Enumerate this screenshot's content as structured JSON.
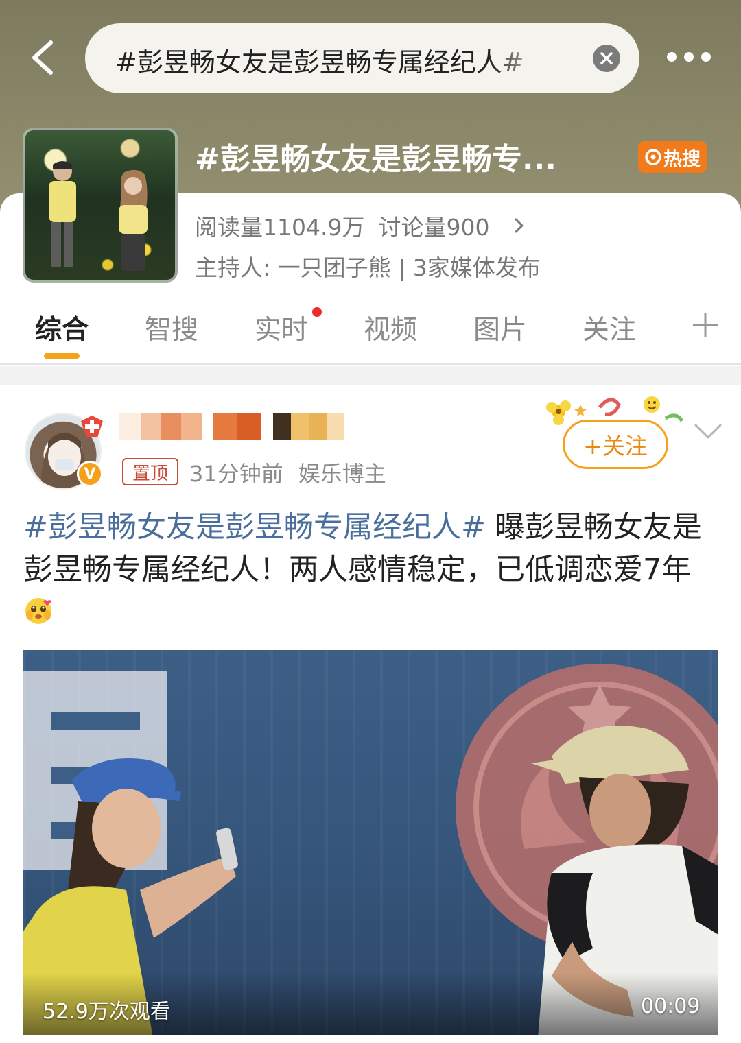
{
  "header": {
    "search_query": "#彭昱畅女友是彭昱畅专属经纪人#",
    "back_icon": "chevron-left-icon",
    "clear_icon": "close-icon",
    "more_icon": "more-dots-icon"
  },
  "topic": {
    "title": "#彭昱畅女友是彭昱畅专...",
    "hot_badge": "热搜",
    "reads_label": "阅读量1104.9万",
    "discussion_label": "讨论量900",
    "host": "主持人: 一只团子熊 | 3家媒体发布"
  },
  "tabs": [
    {
      "label": "综合",
      "active": true
    },
    {
      "label": "智搜"
    },
    {
      "label": "实时",
      "has_dot": true
    },
    {
      "label": "视频"
    },
    {
      "label": "图片"
    },
    {
      "label": "关注"
    }
  ],
  "post": {
    "pinned_label": "置顶",
    "time": "31分钟前",
    "user_type": "娱乐博主",
    "verified_mark": "V",
    "follow_label": "+关注",
    "hashtag": "#彭昱畅女友是彭昱畅专属经纪人#",
    "body": " 曝彭昱畅女友是彭昱畅专属经纪人！两人感情稳定，已低调恋爱7年",
    "video": {
      "views": "52.9万次观看",
      "duration": "00:09"
    }
  },
  "colors": {
    "accent_orange": "#f5a21b",
    "hot_badge": "#f07a1c",
    "hashtag_blue": "#4b6f9d",
    "dot_red": "#ee2b2b",
    "header_olive": "#8a8668"
  }
}
